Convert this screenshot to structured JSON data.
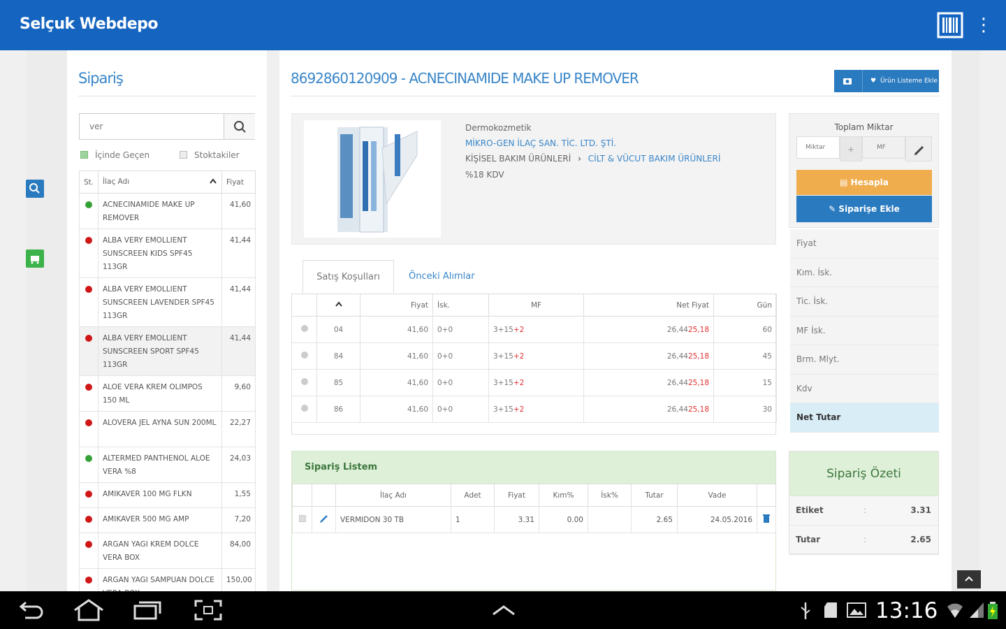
{
  "app": {
    "title": "Selçuk Webdepo"
  },
  "sidebar": {
    "heading": "Sipariş",
    "search": {
      "value": "ver",
      "placeholder": ""
    },
    "filters": [
      {
        "label": "İçinde Geçen",
        "checked": true
      },
      {
        "label": "Stoktakiler",
        "checked": false
      }
    ],
    "columns": [
      "St.",
      "İlaç Adı",
      "Fiyat"
    ],
    "items": [
      {
        "status": "green",
        "name": "ACNECINAMIDE MAKE UP REMOVER",
        "price": "41,60"
      },
      {
        "status": "red",
        "name": "ALBA VERY EMOLLIENT SUNSCREEN KIDS SPF45 113GR",
        "price": "41,44"
      },
      {
        "status": "red",
        "name": "ALBA VERY EMOLLIENT SUNSCREEN LAVENDER SPF45 113GR",
        "price": "41,44"
      },
      {
        "status": "red",
        "name": "ALBA VERY EMOLLIENT SUNSCREEN SPORT SPF45 113GR",
        "price": "41,44"
      },
      {
        "status": "red",
        "name": "ALOE VERA KREM OLIMPOS 150 ML",
        "price": "9,60"
      },
      {
        "status": "red",
        "name": "ALOVERA JEL AYNA SUN 200ML",
        "price": "22,27"
      },
      {
        "status": "green",
        "name": "ALTERMED PANTHENOL ALOE VERA %8",
        "price": "24,03"
      },
      {
        "status": "red",
        "name": "AMIKAVER 100 MG FLKN",
        "price": "1,55"
      },
      {
        "status": "red",
        "name": "AMIKAVER 500 MG AMP",
        "price": "7,20"
      },
      {
        "status": "red",
        "name": "ARGAN YAGI KREM DOLCE VERA BOX",
        "price": "84,00"
      },
      {
        "status": "red",
        "name": "ARGAN YAGI SAMPUAN DOLCE VERA BOX",
        "price": "150,00"
      }
    ]
  },
  "product": {
    "title": "8692860120909 - ACNECINAMIDE MAKE UP REMOVER",
    "header_button": "Ürün Listeme Ekle",
    "category": "Dermokozmetik",
    "company": "MİKRO-GEN İLAÇ SAN. TİC. LTD. ŞTİ.",
    "group": "KİŞİSEL BAKIM ÜRÜNLERİ",
    "subgroup": "CİLT & VÜCUT BAKIM ÜRÜNLERİ",
    "vat": "%18 KDV"
  },
  "tabs": [
    "Satış Koşulları",
    "Önceki Alımlar"
  ],
  "conditions": {
    "columns": [
      "",
      "",
      "Fiyat",
      "İsk.",
      "MF",
      "Net Fiyat",
      "Gün"
    ],
    "rows": [
      {
        "code": "04",
        "price": "41,60",
        "disc": "0+0",
        "mf_a": "3+15",
        "mf_b": "+2",
        "net_a": "26,44",
        "net_b": "25,18",
        "days": "60"
      },
      {
        "code": "84",
        "price": "41,60",
        "disc": "0+0",
        "mf_a": "3+15",
        "mf_b": "+2",
        "net_a": "26,44",
        "net_b": "25,18",
        "days": "45"
      },
      {
        "code": "85",
        "price": "41,60",
        "disc": "0+0",
        "mf_a": "3+15",
        "mf_b": "+2",
        "net_a": "26,44",
        "net_b": "25,18",
        "days": "15"
      },
      {
        "code": "86",
        "price": "41,60",
        "disc": "0+0",
        "mf_a": "3+15",
        "mf_b": "+2",
        "net_a": "26,44",
        "net_b": "25,18",
        "days": "30"
      }
    ]
  },
  "order_list": {
    "heading": "Sipariş Listem",
    "columns": [
      "",
      "",
      "İlaç Adı",
      "Adet",
      "Fiyat",
      "Kım%",
      "İsk%",
      "Tutar",
      "Vade",
      ""
    ],
    "rows": [
      {
        "name": "VERMIDON 30 TB",
        "qty": "1",
        "price": "3.31",
        "kim": "0.00",
        "isk": "",
        "total": "2.65",
        "due": "24.05.2016"
      }
    ]
  },
  "calc": {
    "label": "Toplam Miktar",
    "miktar_placeholder": "Miktar",
    "mf_placeholder": "MF",
    "plus": "+",
    "calc_button": "Hesapla",
    "add_button": "Siparişe Ekle",
    "price_rows": [
      "Fiyat",
      "Kım. İsk.",
      "Tic. İsk.",
      "MF İsk.",
      "Brm. Mlyt.",
      "Kdv",
      "Net Tutar"
    ]
  },
  "summary": {
    "heading": "Sipariş Özeti",
    "rows": [
      {
        "label": "Etiket",
        "sep": ":",
        "value": "3.31"
      },
      {
        "label": "Tutar",
        "sep": ":",
        "value": "2.65"
      }
    ]
  },
  "status_bar": {
    "time": "13:16"
  },
  "colors": {
    "primary": "#1565c0",
    "accent": "#2a7abf",
    "warning": "#f0ad4e",
    "success_bg": "#dff0d8"
  }
}
